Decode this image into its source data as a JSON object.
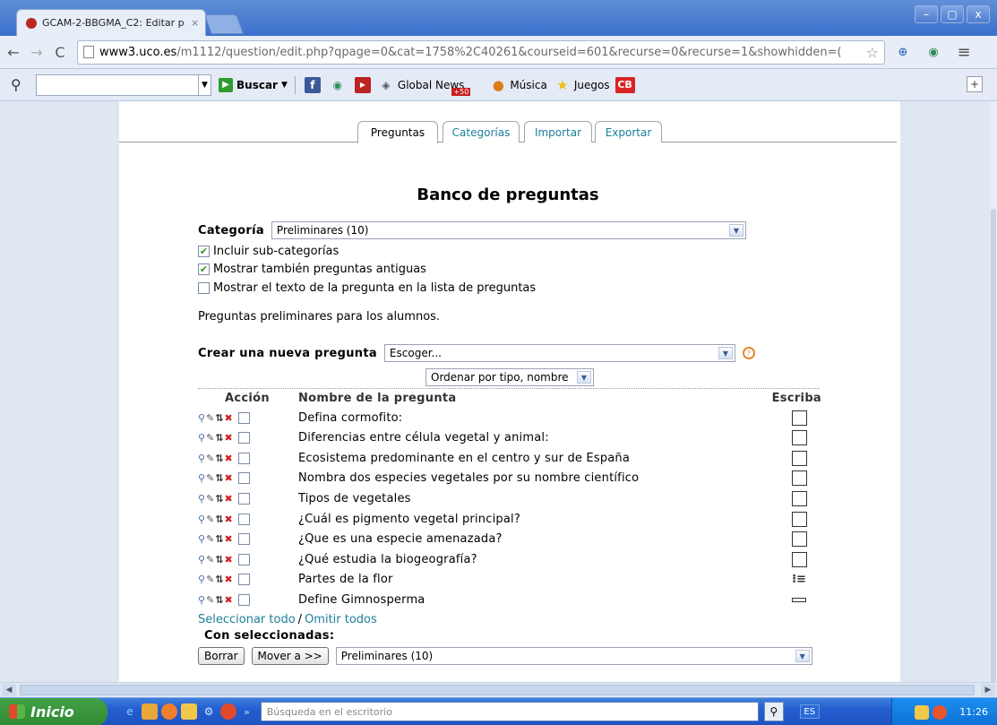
{
  "browser": {
    "tab_title": "GCAM-2-BBGMA_C2: Editar p",
    "tab_close": "×",
    "url_host": "www3.uco.es",
    "url_path": "/m1112/question/edit.php?qpage=0&cat=1758%2C40261&courseid=601&recurse=0&recurse=1&showhidden=(",
    "window_buttons": [
      "–",
      "▢",
      "x"
    ]
  },
  "searchbar": {
    "buscar_label": "Buscar",
    "links": [
      {
        "icon": "globe-icon",
        "label": "Global News",
        "badge": "+50"
      },
      {
        "icon": "music-icon",
        "label": "Música"
      },
      {
        "icon": "star-icon",
        "label": "Juegos"
      }
    ],
    "cb_label": "CB",
    "fb_label": "f",
    "plus_label": "+"
  },
  "tabs": [
    {
      "label": "Preguntas",
      "active": true
    },
    {
      "label": "Categorías",
      "active": false
    },
    {
      "label": "Importar",
      "active": false
    },
    {
      "label": "Exportar",
      "active": false
    }
  ],
  "heading": "Banco de preguntas",
  "category": {
    "label": "Categoría",
    "value": "Preliminares (10)"
  },
  "options": [
    {
      "label": "Incluir sub-categorías",
      "checked": true
    },
    {
      "label": "Mostrar también preguntas antiguas",
      "checked": true
    },
    {
      "label": "Mostrar el texto de la pregunta en la lista de preguntas",
      "checked": false
    }
  ],
  "category_description": "Preguntas preliminares para los alumnos.",
  "create": {
    "label": "Crear una nueva pregunta",
    "value": "Escoger..."
  },
  "sort": {
    "value": "Ordenar por tipo, nombre"
  },
  "table": {
    "headers": {
      "action": "Acción",
      "name": "Nombre de la pregunta",
      "type": "Escriba"
    },
    "rows": [
      {
        "name": "Defina cormofito:",
        "type_icon": "box-icon"
      },
      {
        "name": "Diferencias entre célula vegetal y animal:",
        "type_icon": "box-icon"
      },
      {
        "name": "Ecosistema predominante en el centro y sur de España",
        "type_icon": "box-icon"
      },
      {
        "name": "Nombra dos especies vegetales por su nombre científico",
        "type_icon": "box-icon"
      },
      {
        "name": "Tipos de vegetales",
        "type_icon": "box-icon"
      },
      {
        "name": "¿Cuál es pigmento vegetal principal?",
        "type_icon": "box-icon"
      },
      {
        "name": "¿Que es una especie amenazada?",
        "type_icon": "box-icon"
      },
      {
        "name": "¿Qué estudia la biogeografía?",
        "type_icon": "box-icon"
      },
      {
        "name": "Partes de la flor",
        "type_icon": "list-icon"
      },
      {
        "name": "Define Gimnosperma",
        "type_icon": "shortanswer-icon"
      }
    ]
  },
  "select_all": "Seleccionar todo",
  "select_sep": "/",
  "deselect_all": "Omitir todos",
  "with_selected": "Con seleccionadas:",
  "delete_button": "Borrar",
  "move_button": "Mover a >>",
  "move_target": "Preliminares (10)",
  "taskbar": {
    "start_label": "Inicio",
    "search_placeholder": "Búsqueda en el escritorio",
    "lang": "ES",
    "clock": "11:26"
  }
}
